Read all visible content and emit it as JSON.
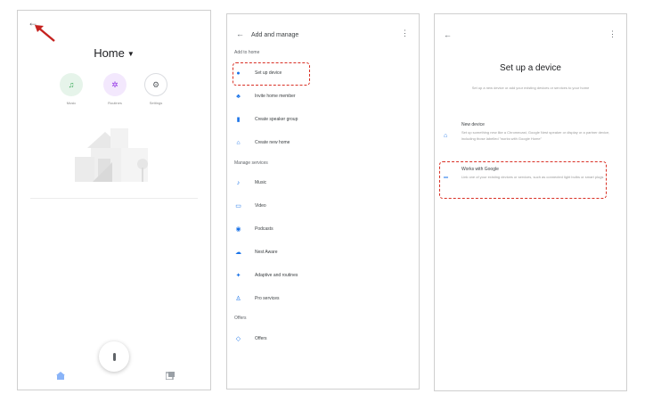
{
  "screen1": {
    "back": "←",
    "title": "Home",
    "shortcuts": [
      {
        "label": "Music",
        "icon": "music-note-icon",
        "glyph": "♫",
        "bg": "#e6f4ea",
        "fg": "#34a853"
      },
      {
        "label": "Routines",
        "icon": "sparkle-icon",
        "glyph": "✲",
        "bg": "#f3e8fd",
        "fg": "#9334e6"
      },
      {
        "label": "Settings",
        "icon": "gear-icon",
        "glyph": "⚙",
        "bg": "#ffffff",
        "fg": "#5f6368"
      }
    ]
  },
  "screen2": {
    "back": "←",
    "title": "Add and manage",
    "add_section": "Add to home",
    "add_items": [
      {
        "label": "Set up device",
        "icon": "plus-circle-icon",
        "glyph": "●"
      },
      {
        "label": "Invite home member",
        "icon": "add-person-icon",
        "glyph": "♣"
      },
      {
        "label": "Create speaker group",
        "icon": "speaker-icon",
        "glyph": "▮"
      },
      {
        "label": "Create new home",
        "icon": "home-icon",
        "glyph": "⌂"
      }
    ],
    "manage_section": "Manage services",
    "manage_items": [
      {
        "label": "Music",
        "icon": "music-note-icon",
        "glyph": "♪"
      },
      {
        "label": "Video",
        "icon": "video-icon",
        "glyph": "▭"
      },
      {
        "label": "Podcasts",
        "icon": "podcast-icon",
        "glyph": "◉"
      },
      {
        "label": "Nest Aware",
        "icon": "nest-icon",
        "glyph": "☁"
      },
      {
        "label": "Adaptive and routines",
        "icon": "routine-icon",
        "glyph": "✦"
      },
      {
        "label": "Pro services",
        "icon": "person-icon",
        "glyph": "♙"
      }
    ],
    "offers_section": "Offers",
    "offers_items": [
      {
        "label": "Offers",
        "icon": "tag-icon",
        "glyph": "◇"
      }
    ]
  },
  "screen3": {
    "back": "←",
    "title": "Set up a device",
    "subtitle": "Set up a new device or add your existing devices or services to your home",
    "options": [
      {
        "name": "New device",
        "icon": "home-icon",
        "glyph": "⌂",
        "desc": "Set up something new like a Chromecast, Google Nest speaker or display or a partner device, including those labelled \"works with Google Home\""
      },
      {
        "name": "Works with Google",
        "icon": "link-icon",
        "glyph": "═",
        "desc": "Link one of your existing devices or services, such as connected light bulbs or smart plugs"
      }
    ]
  },
  "colors": {
    "accent": "#1a73e8",
    "highlight": "#d93025",
    "arrow": "#c5221f"
  }
}
